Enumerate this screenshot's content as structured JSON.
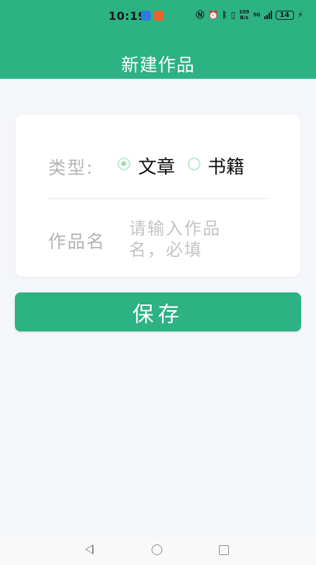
{
  "status_bar": {
    "time": "10:19",
    "net_speed_value": "109",
    "net_speed_unit": "B/s",
    "network": "5G",
    "battery": "14",
    "icons": [
      "nfc-icon",
      "alarm-icon",
      "bluetooth-icon",
      "vibrate-icon",
      "signal-icon",
      "battery-icon",
      "charging-icon"
    ]
  },
  "header": {
    "title": "新建作品"
  },
  "form": {
    "type_label": "类型:",
    "options": [
      {
        "label": "文章",
        "checked": true
      },
      {
        "label": "书籍",
        "checked": false
      }
    ],
    "name_label": "作品名",
    "name_placeholder": "请输入作品名，必填"
  },
  "save_label": "保存",
  "colors": {
    "primary": "#2db283",
    "background": "#f5f6fa",
    "radio": "#9fdcb4"
  },
  "nav_bar": {
    "icons": [
      "back-icon",
      "home-icon",
      "recent-apps-icon"
    ]
  }
}
